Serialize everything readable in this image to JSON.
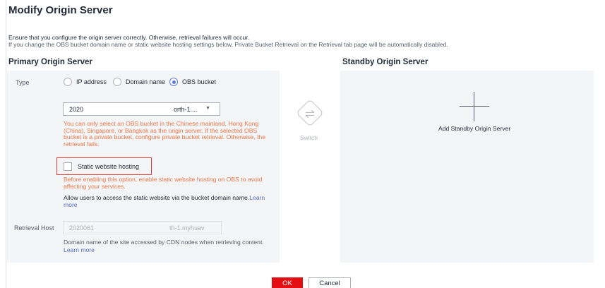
{
  "dialog": {
    "title": "Modify Origin Server",
    "notice_line1": "Ensure that you configure the origin server correctly. Otherwise, retrieval failures will occur.",
    "notice_line2": "If you change the OBS bucket domain name or static website hosting settings below, Private Bucket Retrieval on the Retrieval tab page will be automatically disabled."
  },
  "primary": {
    "section_title": "Primary Origin Server",
    "type_label": "Type",
    "type_options": [
      {
        "label": "IP address",
        "checked": false
      },
      {
        "label": "Domain name",
        "checked": false
      },
      {
        "label": "OBS bucket",
        "checked": true
      }
    ],
    "bucket_select": {
      "value_start": "2020",
      "value_end": "orth-1....",
      "caret": "▼"
    },
    "bucket_warning": "You can only select an OBS bucket in the Chinese mainland, Hong Kong (China), Singapore, or Bangkok as the origin server. If the selected OBS bucket is a private bucket, configure private bucket retrieval. Otherwise, the retrieval fails.",
    "static_hosting": {
      "label": "Static website hosting",
      "checked": false
    },
    "static_warning": "Before enabling this option, enable static website hosting on OBS to avoid affecting your services.",
    "access_text": "Allow users to access the static website via the bucket domain name.",
    "learn_more_1": "Learn more",
    "retrieval_host_label": "Retrieval Host",
    "retrieval_host": {
      "value_start": "2020061",
      "value_end": "th-1.myhuav"
    },
    "host_hint": "Domain name of the site accessed by CDN nodes when retrieving content.",
    "learn_more_2": "Learn more"
  },
  "switch": {
    "label": "Switch",
    "icon": "swap-arrows-icon"
  },
  "standby": {
    "section_title": "Standby Origin Server",
    "add_label": "Add Standby Origin Server",
    "icon": "plus-icon"
  },
  "footer": {
    "ok_label": "OK",
    "cancel_label": "Cancel"
  },
  "colors": {
    "accent": "#5e7ce0",
    "warning": "#ed7444",
    "ok_button": "#e30d12",
    "highlight_border": "#e33b3b",
    "panel_bg": "#f4f5f7"
  }
}
